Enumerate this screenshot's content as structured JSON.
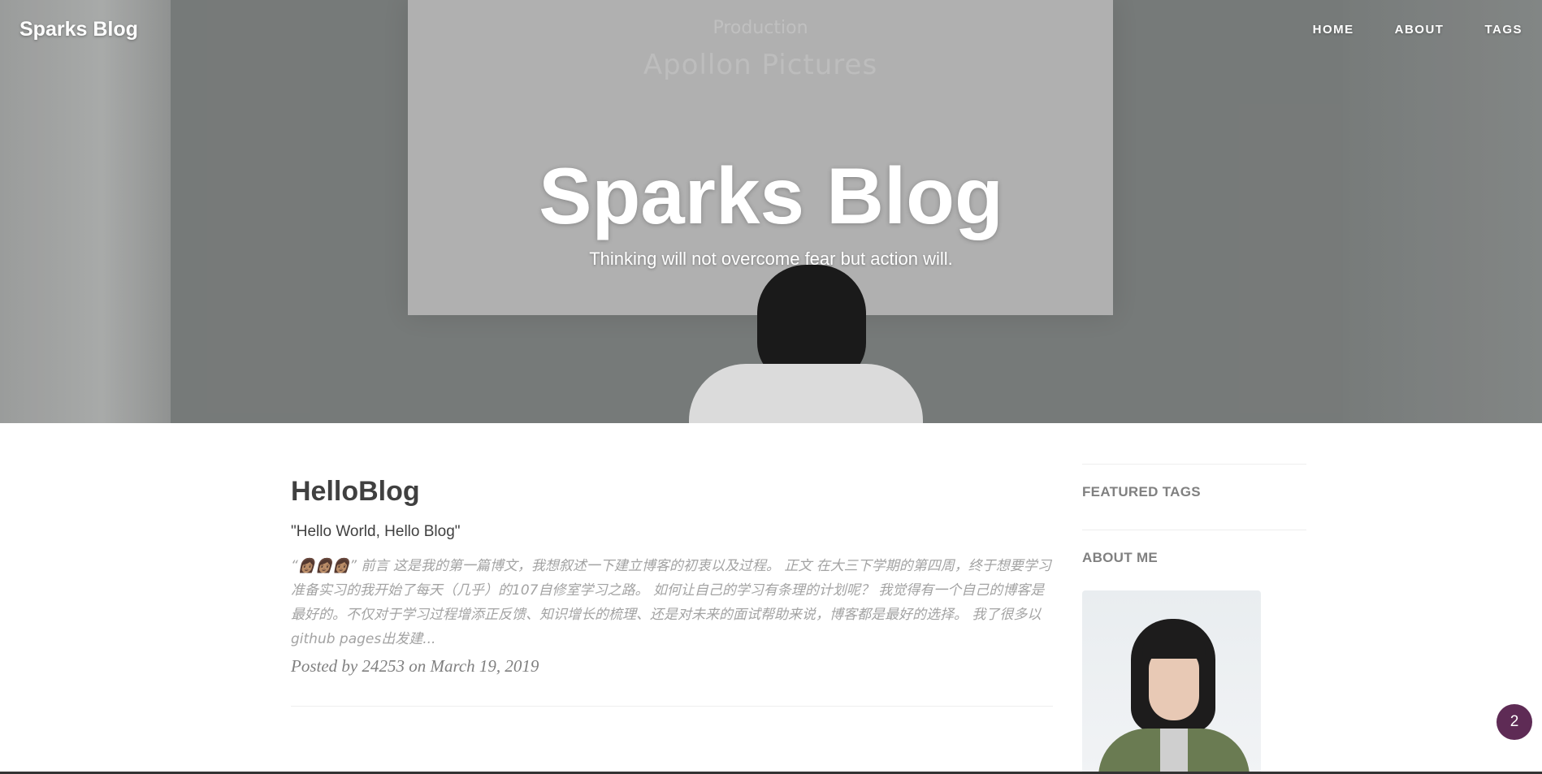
{
  "header": {
    "brand": "Sparks Blog",
    "nav": [
      "HOME",
      "ABOUT",
      "TAGS"
    ]
  },
  "hero": {
    "screen_small": "Production",
    "screen_large": "Apollon Pictures",
    "title": "Sparks Blog",
    "subtitle": "Thinking will not overcome fear but action will."
  },
  "post": {
    "title": "HelloBlog",
    "subtitle": "\"Hello World, Hello Blog\"",
    "excerpt": "“👩🏽👩🏽👩🏽” 前言 这是我的第一篇博文，我想叙述一下建立博客的初衷以及过程。 正文 在大三下学期的第四周，终于想要学习准备实习的我开始了每天（几乎）的107自修室学习之路。 如何让自己的学习有条理的计划呢？ 我觉得有一个自己的博客是最好的。不仅对于学习过程增添正反馈、知识增长的梳理、还是对未来的面试帮助来说，博客都是最好的选择。 我了很多以github pages出发建...",
    "meta": "Posted by 24253 on March 19, 2019"
  },
  "sidebar": {
    "featured_tags": "FEATURED TAGS",
    "about_me": "ABOUT ME"
  },
  "badge": {
    "count": "2"
  },
  "colors": {
    "badge": "#5e2b55",
    "text_dark": "#404040",
    "text_muted": "#a3a3a3"
  }
}
